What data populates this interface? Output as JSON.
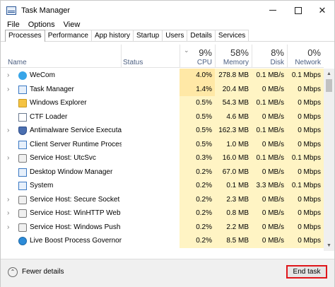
{
  "window": {
    "title": "Task Manager"
  },
  "menu": [
    "File",
    "Options",
    "View"
  ],
  "tabs": [
    "Processes",
    "Performance",
    "App history",
    "Startup",
    "Users",
    "Details",
    "Services"
  ],
  "header": {
    "name": "Name",
    "status": "Status",
    "cpu": {
      "pct": "9%",
      "label": "CPU"
    },
    "memory": {
      "pct": "58%",
      "label": "Memory"
    },
    "disk": {
      "pct": "8%",
      "label": "Disk"
    },
    "network": {
      "pct": "0%",
      "label": "Network"
    }
  },
  "rows": [
    {
      "expand": true,
      "icon": "wecom-icon",
      "name": "WeCom",
      "cpu": "4.0%",
      "mem": "278.8 MB",
      "disk": "0.1 MB/s",
      "net": "0.1 Mbps"
    },
    {
      "expand": true,
      "icon": "task-manager-icon",
      "name": "Task Manager",
      "cpu": "1.4%",
      "mem": "20.4 MB",
      "disk": "0 MB/s",
      "net": "0 Mbps"
    },
    {
      "expand": false,
      "icon": "folder-icon",
      "name": "Windows Explorer",
      "cpu": "0.5%",
      "mem": "54.3 MB",
      "disk": "0.1 MB/s",
      "net": "0 Mbps"
    },
    {
      "expand": false,
      "icon": "document-icon",
      "name": "CTF Loader",
      "cpu": "0.5%",
      "mem": "4.6 MB",
      "disk": "0 MB/s",
      "net": "0 Mbps"
    },
    {
      "expand": true,
      "icon": "shield-icon",
      "name": "Antimalware Service Executable",
      "cpu": "0.5%",
      "mem": "162.3 MB",
      "disk": "0.1 MB/s",
      "net": "0 Mbps"
    },
    {
      "expand": false,
      "icon": "window-icon",
      "name": "Client Server Runtime Process",
      "cpu": "0.5%",
      "mem": "1.0 MB",
      "disk": "0 MB/s",
      "net": "0 Mbps"
    },
    {
      "expand": true,
      "icon": "gear-icon",
      "name": "Service Host: UtcSvc",
      "cpu": "0.3%",
      "mem": "16.0 MB",
      "disk": "0.1 MB/s",
      "net": "0.1 Mbps"
    },
    {
      "expand": false,
      "icon": "window-icon",
      "name": "Desktop Window Manager",
      "cpu": "0.2%",
      "mem": "67.0 MB",
      "disk": "0 MB/s",
      "net": "0 Mbps"
    },
    {
      "expand": false,
      "icon": "window-icon",
      "name": "System",
      "cpu": "0.2%",
      "mem": "0.1 MB",
      "disk": "3.3 MB/s",
      "net": "0.1 Mbps"
    },
    {
      "expand": true,
      "icon": "gear-icon",
      "name": "Service Host: Secure Socket Tun...",
      "cpu": "0.2%",
      "mem": "2.3 MB",
      "disk": "0 MB/s",
      "net": "0 Mbps"
    },
    {
      "expand": true,
      "icon": "gear-icon",
      "name": "Service Host: WinHTTP Web Pro...",
      "cpu": "0.2%",
      "mem": "0.8 MB",
      "disk": "0 MB/s",
      "net": "0 Mbps"
    },
    {
      "expand": true,
      "icon": "gear-icon",
      "name": "Service Host: Windows Push No...",
      "cpu": "0.2%",
      "mem": "2.2 MB",
      "disk": "0 MB/s",
      "net": "0 Mbps"
    },
    {
      "expand": false,
      "icon": "globe-icon",
      "name": "Live Boost Process Governor",
      "cpu": "0.2%",
      "mem": "8.5 MB",
      "disk": "0 MB/s",
      "net": "0 Mbps"
    }
  ],
  "footer": {
    "fewer_details": "Fewer details",
    "end_task": "End task"
  },
  "colors": {
    "highlight": "#fff4c4",
    "end_task_border": "#e0161b"
  }
}
